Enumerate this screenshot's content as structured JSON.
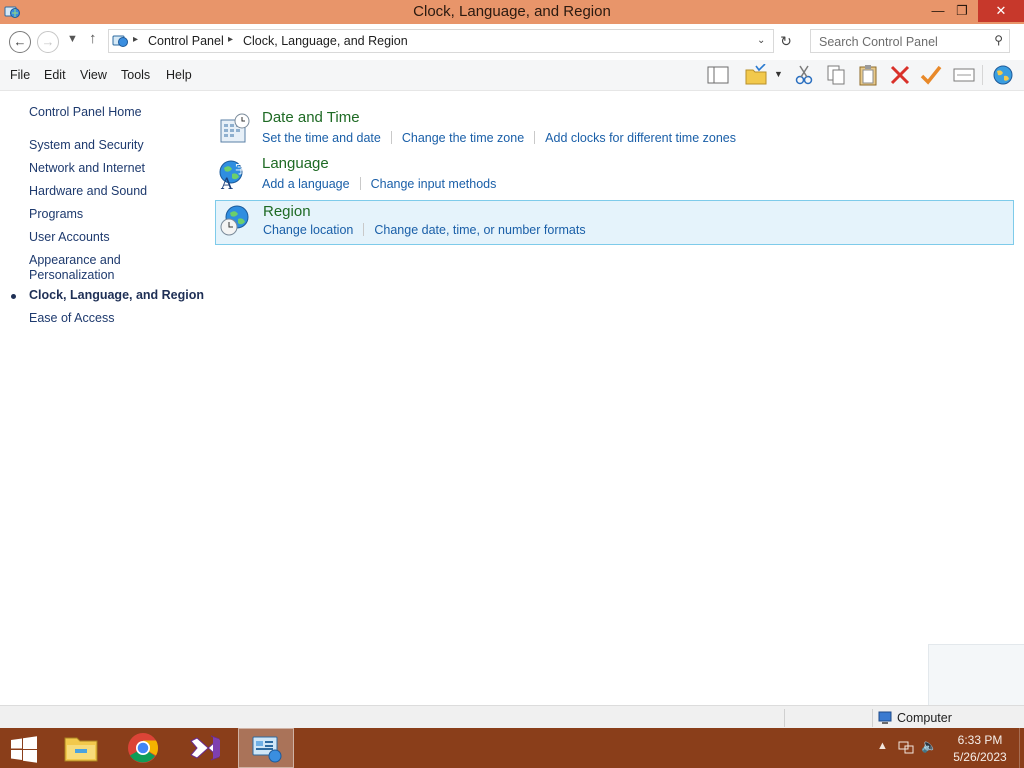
{
  "window": {
    "title": "Clock, Language, and Region"
  },
  "address": {
    "root": "Control Panel",
    "current": "Clock, Language, and Region"
  },
  "search": {
    "placeholder": "Search Control Panel"
  },
  "menu": [
    "File",
    "Edit",
    "View",
    "Tools",
    "Help"
  ],
  "sidebar": {
    "home": "Control Panel Home",
    "items": [
      "System and Security",
      "Network and Internet",
      "Hardware and Sound",
      "Programs",
      "User Accounts",
      "Appearance and",
      "Personalization",
      "Clock, Language, and Region",
      "Ease of Access"
    ]
  },
  "categories": [
    {
      "title": "Date and Time",
      "links": [
        "Set the time and date",
        "Change the time zone",
        "Add clocks for different time zones"
      ]
    },
    {
      "title": "Language",
      "links": [
        "Add a language",
        "Change input methods"
      ]
    },
    {
      "title": "Region",
      "links": [
        "Change location",
        "Change date, time, or number formats"
      ]
    }
  ],
  "status": {
    "zone": "Computer"
  },
  "clock": {
    "time": "6:33 PM",
    "date": "5/26/2023"
  },
  "colors": {
    "titlebar": "#e8956a",
    "taskbar": "#8a3e1a",
    "link": "#1a5fa8",
    "heading": "#1e6a24",
    "selection": "#e5f3fb"
  }
}
